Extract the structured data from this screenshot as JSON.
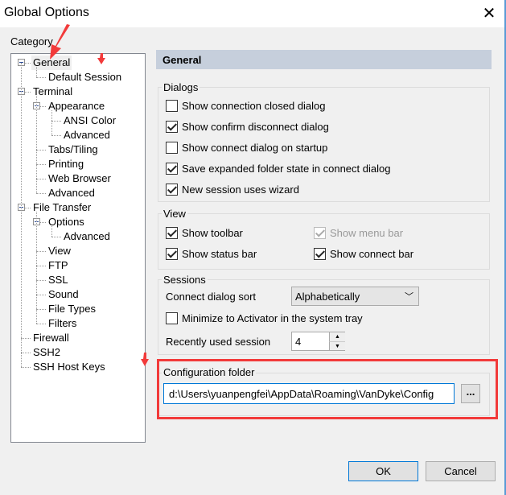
{
  "window": {
    "title": "Global Options",
    "close_icon": "close-icon"
  },
  "category": {
    "label": "Category",
    "items": [
      {
        "label": "General",
        "level": 0,
        "expanded": true,
        "selected": true
      },
      {
        "label": "Default Session",
        "level": 1
      },
      {
        "label": "Terminal",
        "level": 0,
        "expanded": true
      },
      {
        "label": "Appearance",
        "level": 1,
        "expanded": true
      },
      {
        "label": "ANSI Color",
        "level": 2
      },
      {
        "label": "Advanced",
        "level": 2
      },
      {
        "label": "Tabs/Tiling",
        "level": 1
      },
      {
        "label": "Printing",
        "level": 1
      },
      {
        "label": "Web Browser",
        "level": 1
      },
      {
        "label": "Advanced",
        "level": 1
      },
      {
        "label": "File Transfer",
        "level": 0,
        "expanded": true
      },
      {
        "label": "Options",
        "level": 1,
        "expanded": true
      },
      {
        "label": "Advanced",
        "level": 2
      },
      {
        "label": "View",
        "level": 1
      },
      {
        "label": "FTP",
        "level": 1
      },
      {
        "label": "SSL",
        "level": 1
      },
      {
        "label": "Sound",
        "level": 1
      },
      {
        "label": "File Types",
        "level": 1
      },
      {
        "label": "Filters",
        "level": 1
      },
      {
        "label": "Firewall",
        "level": 0
      },
      {
        "label": "SSH2",
        "level": 0
      },
      {
        "label": "SSH Host Keys",
        "level": 0
      }
    ]
  },
  "panel": {
    "header": "General",
    "dialogs": {
      "label": "Dialogs",
      "options": [
        {
          "label": "Show connection closed dialog",
          "checked": false
        },
        {
          "label": "Show confirm disconnect dialog",
          "checked": true
        },
        {
          "label": "Show connect dialog on startup",
          "checked": false
        },
        {
          "label": "Save expanded folder state in connect dialog",
          "checked": true
        },
        {
          "label": "New session uses wizard",
          "checked": true
        }
      ]
    },
    "view": {
      "label": "View",
      "options": [
        {
          "label": "Show toolbar",
          "checked": true,
          "disabled": false
        },
        {
          "label": "Show menu bar",
          "checked": true,
          "disabled": true
        },
        {
          "label": "Show status bar",
          "checked": true,
          "disabled": false
        },
        {
          "label": "Show connect bar",
          "checked": true,
          "disabled": false
        }
      ]
    },
    "sessions": {
      "label": "Sessions",
      "sort_label": "Connect dialog sort",
      "sort_value": "Alphabetically",
      "minimize_label": "Minimize to Activator in the system tray",
      "minimize_checked": false,
      "recent_label": "Recently used session",
      "recent_value": "4"
    },
    "config": {
      "label": "Configuration folder",
      "value": "d:\\Users\\yuanpengfei\\AppData\\Roaming\\VanDyke\\Config",
      "browse_label": "..."
    }
  },
  "buttons": {
    "ok": "OK",
    "cancel": "Cancel"
  },
  "annotation_color": "#f23a3a"
}
